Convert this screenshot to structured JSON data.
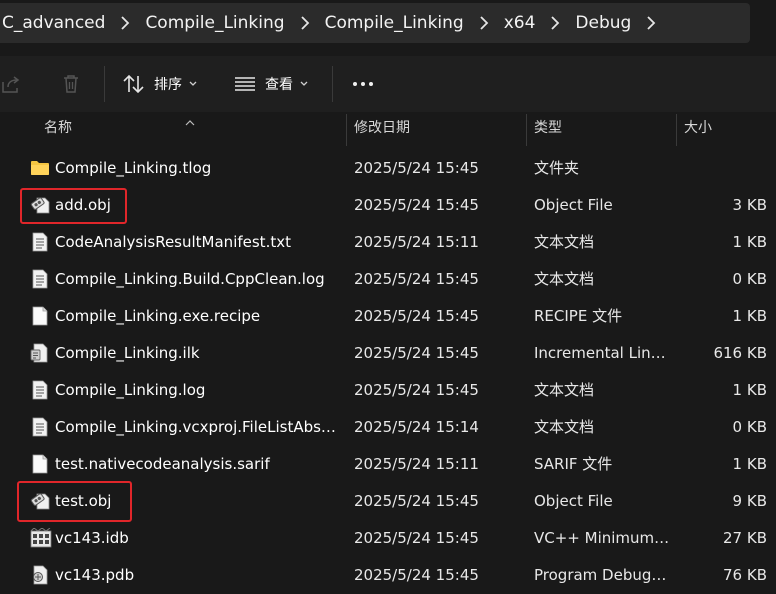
{
  "breadcrumb": [
    "C_advanced",
    "Compile_Linking",
    "Compile_Linking",
    "x64",
    "Debug"
  ],
  "toolbar": {
    "sort_label": "排序",
    "view_label": "查看",
    "more_label": "..."
  },
  "columns": {
    "name": "名称",
    "date": "修改日期",
    "type": "类型",
    "size": "大小"
  },
  "files": [
    {
      "name": "Compile_Linking.tlog",
      "date": "2025/5/24 15:45",
      "type": "文件夹",
      "size": "",
      "icon": "folder-icon"
    },
    {
      "name": "add.obj",
      "date": "2025/5/24 15:45",
      "type": "Object File",
      "size": "3 KB",
      "icon": "object-file-icon"
    },
    {
      "name": "CodeAnalysisResultManifest.txt",
      "date": "2025/5/24 15:11",
      "type": "文本文档",
      "size": "1 KB",
      "icon": "text-document-icon"
    },
    {
      "name": "Compile_Linking.Build.CppClean.log",
      "date": "2025/5/24 15:45",
      "type": "文本文档",
      "size": "0 KB",
      "icon": "text-document-icon"
    },
    {
      "name": "Compile_Linking.exe.recipe",
      "date": "2025/5/24 15:45",
      "type": "RECIPE 文件",
      "size": "1 KB",
      "icon": "blank-file-icon"
    },
    {
      "name": "Compile_Linking.ilk",
      "date": "2025/5/24 15:45",
      "type": "Incremental Link...",
      "size": "616 KB",
      "icon": "ilk-file-icon"
    },
    {
      "name": "Compile_Linking.log",
      "date": "2025/5/24 15:45",
      "type": "文本文档",
      "size": "1 KB",
      "icon": "text-document-icon"
    },
    {
      "name": "Compile_Linking.vcxproj.FileListAbso...",
      "date": "2025/5/24 15:14",
      "type": "文本文档",
      "size": "0 KB",
      "icon": "text-document-icon"
    },
    {
      "name": "test.nativecodeanalysis.sarif",
      "date": "2025/5/24 15:11",
      "type": "SARIF 文件",
      "size": "1 KB",
      "icon": "blank-file-icon"
    },
    {
      "name": "test.obj",
      "date": "2025/5/24 15:45",
      "type": "Object File",
      "size": "9 KB",
      "icon": "object-file-icon"
    },
    {
      "name": "vc143.idb",
      "date": "2025/5/24 15:45",
      "type": "VC++ Minimum ...",
      "size": "27 KB",
      "icon": "idb-file-icon"
    },
    {
      "name": "vc143.pdb",
      "date": "2025/5/24 15:45",
      "type": "Program Debug ...",
      "size": "76 KB",
      "icon": "pdb-file-icon"
    }
  ],
  "highlighted_files": [
    "add.obj",
    "test.obj"
  ],
  "colors": {
    "background": "#191919",
    "toolbar": "#1f1f1f",
    "breadcrumb_bg": "#2b2b2b",
    "highlight": "#e0262a",
    "folder": "#f4c542"
  }
}
